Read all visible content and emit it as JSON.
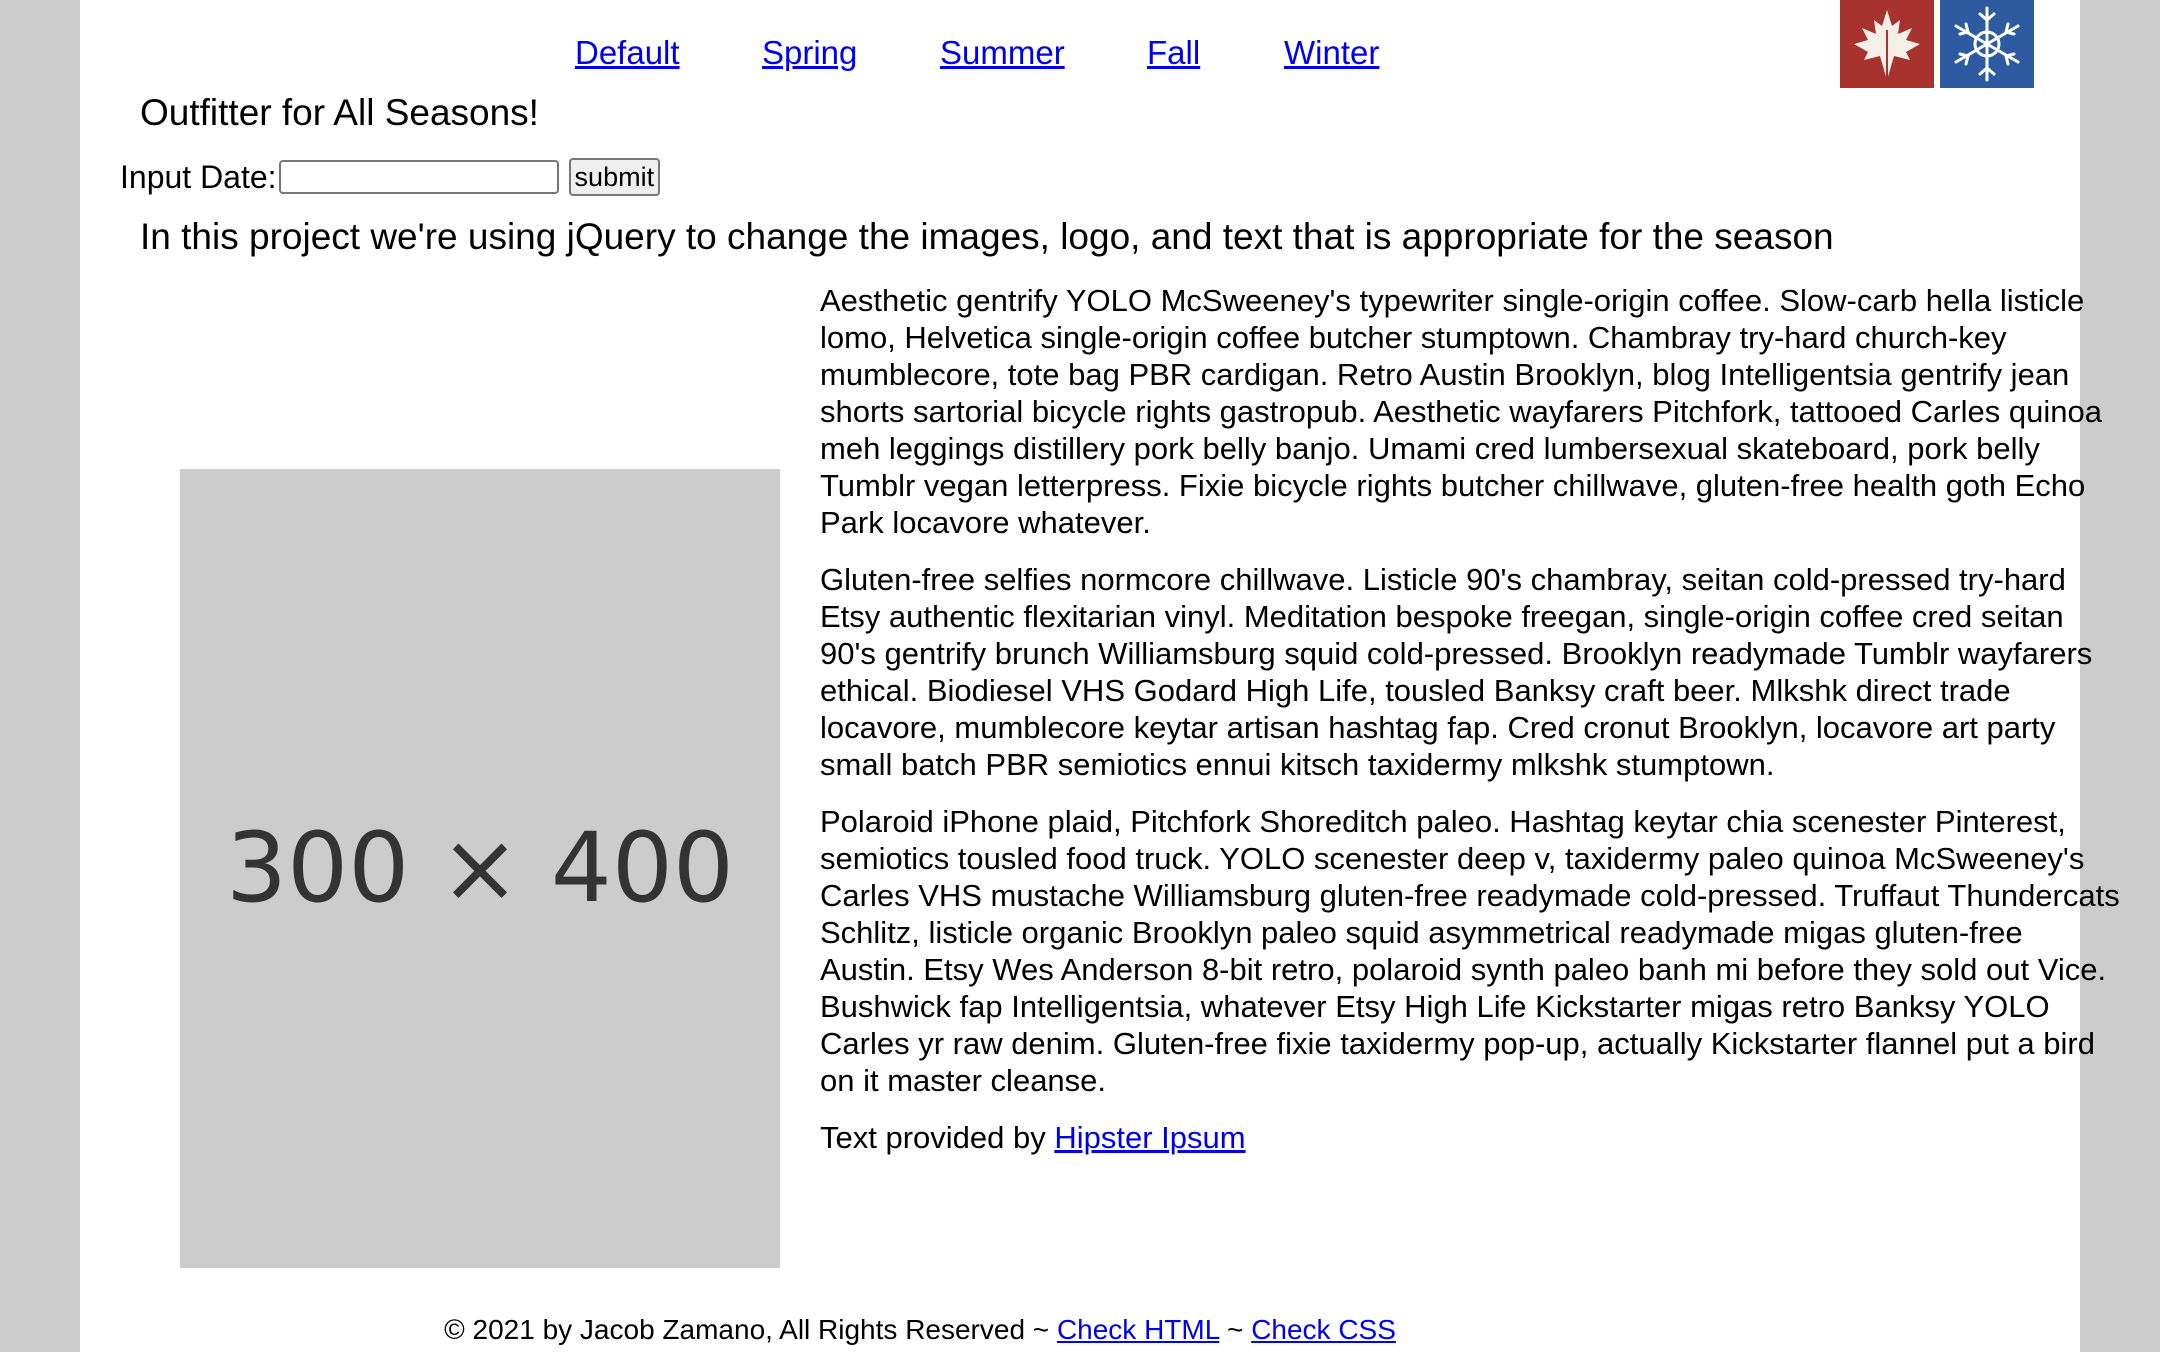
{
  "nav": {
    "items": [
      "Default",
      "Spring",
      "Summer",
      "Fall",
      "Winter"
    ]
  },
  "logos": {
    "fall_icon": "maple-leaf-icon",
    "winter_icon": "snowflake-icon",
    "fall_color": "#a8322d",
    "winter_color": "#2d5aa0"
  },
  "header": {
    "title": "Outfitter for All Seasons!"
  },
  "date_form": {
    "label": "Input Date:",
    "value": "",
    "submit_label": "submit"
  },
  "main": {
    "subtitle": "In this project we're using jQuery to change the images, logo, and text that is appropriate for the season",
    "image_label": "300 × 400",
    "paragraphs": [
      "Aesthetic gentrify YOLO McSweeney's typewriter single-origin coffee. Slow-carb hella listicle lomo, Helvetica single-origin coffee butcher stumptown. Chambray try-hard church-key mumblecore, tote bag PBR cardigan. Retro Austin Brooklyn, blog Intelligentsia gentrify jean shorts sartorial bicycle rights gastropub. Aesthetic wayfarers Pitchfork, tattooed Carles quinoa meh leggings distillery pork belly banjo. Umami cred lumbersexual skateboard, pork belly Tumblr vegan letterpress. Fixie bicycle rights butcher chillwave, gluten-free health goth Echo Park locavore whatever.",
      "Gluten-free selfies normcore chillwave. Listicle 90's chambray, seitan cold-pressed try-hard Etsy authentic flexitarian vinyl. Meditation bespoke freegan, single-origin coffee cred seitan 90's gentrify brunch Williamsburg squid cold-pressed. Brooklyn readymade Tumblr wayfarers ethical. Biodiesel VHS Godard High Life, tousled Banksy craft beer. Mlkshk direct trade locavore, mumblecore keytar artisan hashtag fap. Cred cronut Brooklyn, locavore art party small batch PBR semiotics ennui kitsch taxidermy mlkshk stumptown.",
      "Polaroid iPhone plaid, Pitchfork Shoreditch paleo. Hashtag keytar chia scenester Pinterest, semiotics tousled food truck. YOLO scenester deep v, taxidermy paleo quinoa McSweeney's Carles VHS mustache Williamsburg gluten-free readymade cold-pressed. Truffaut Thundercats Schlitz, listicle organic Brooklyn paleo squid asymmetrical readymade migas gluten-free Austin. Etsy Wes Anderson 8-bit retro, polaroid synth paleo banh mi before they sold out Vice. Bushwick fap Intelligentsia, whatever Etsy High Life Kickstarter migas retro Banksy YOLO Carles yr raw denim. Gluten-free fixie taxidermy pop-up, actually Kickstarter flannel put a bird on it master cleanse."
    ],
    "credit_prefix": "Text provided by ",
    "credit_link": "Hipster Ipsum"
  },
  "footer": {
    "copyright": "© 2021 by Jacob Zamano, All Rights Reserved ~ ",
    "check_html": "Check HTML",
    "separator": " ~ ",
    "check_css": "Check CSS"
  }
}
